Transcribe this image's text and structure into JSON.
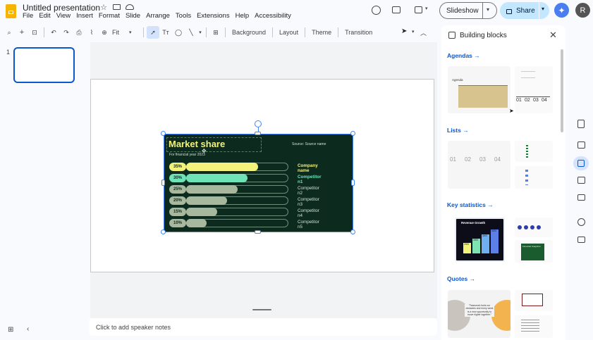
{
  "app": {
    "title": "Untitled presentation",
    "menus": [
      "File",
      "Edit",
      "View",
      "Insert",
      "Format",
      "Slide",
      "Arrange",
      "Tools",
      "Extensions",
      "Help",
      "Accessibility"
    ],
    "slideshow_label": "Slideshow",
    "share_label": "Share",
    "avatar_letter": "R",
    "accent": "#0b57d0"
  },
  "toolbar": {
    "zoom": "Fit",
    "background": "Background",
    "layout": "Layout",
    "theme": "Theme",
    "transition": "Transition"
  },
  "filmstrip": {
    "slide_number": "1"
  },
  "slide": {
    "title": "Market share",
    "subtitle": "For financial year 2023",
    "source": "Source: Source name",
    "bg": "#0d2a1f",
    "rows": [
      {
        "pct": "35%",
        "label": "Company name",
        "value": 35,
        "color": "#f4f27a",
        "highlight": true
      },
      {
        "pct": "30%",
        "label": "Competitor n1",
        "value": 30,
        "color": "#6fe3b6",
        "highlight": true
      },
      {
        "pct": "25%",
        "label": "Competitor n2",
        "value": 25,
        "color": "#a7b89e",
        "highlight": false
      },
      {
        "pct": "20%",
        "label": "Competitor n3",
        "value": 20,
        "color": "#a7b89e",
        "highlight": false
      },
      {
        "pct": "15%",
        "label": "Competitor n4",
        "value": 15,
        "color": "#a7b89e",
        "highlight": false
      },
      {
        "pct": "10%",
        "label": "Competitor n5",
        "value": 10,
        "color": "#a7b89e",
        "highlight": false
      }
    ]
  },
  "notes": {
    "placeholder": "Click to add speaker notes"
  },
  "panel": {
    "title": "Building blocks",
    "sections": [
      {
        "label": "Agendas"
      },
      {
        "label": "Lists"
      },
      {
        "label": "Key statistics"
      },
      {
        "label": "Quotes"
      }
    ],
    "agenda_thumb": {
      "title": "Agenda",
      "numbers": [
        "01",
        "02",
        "03",
        "04"
      ]
    },
    "lists_thumb": {
      "numbers": [
        "01",
        "02",
        "03",
        "04"
      ]
    },
    "stats_thumb": {
      "title": "Revenue Growth",
      "values": [
        "2000",
        "3000",
        "4000",
        "5000"
      ],
      "small_title": "Financial Snapshot"
    },
    "quote_thumb": {
      "text": "\"Teamwork fuels our obstacles and every week is a new opportunity to move higher together.\""
    }
  }
}
